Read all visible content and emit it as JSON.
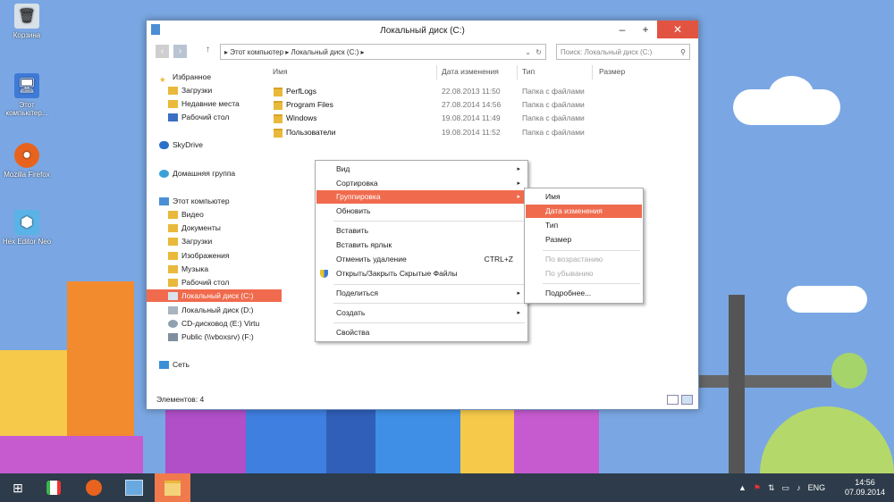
{
  "desktop": {
    "icons": [
      {
        "label": "Корзина",
        "icon": "recycle-bin-icon"
      },
      {
        "label": "Этот компьютер...",
        "icon": "computer-icon"
      },
      {
        "label": "Mozilla Firefox",
        "icon": "firefox-icon"
      },
      {
        "label": "Hex Editor Neo",
        "icon": "hex-editor-icon"
      }
    ]
  },
  "window": {
    "title": "Локальный диск (C:)",
    "address": "▸  Этот компьютер  ▸  Локальный диск (C:)  ▸",
    "search_placeholder": "Поиск: Локальный диск (C:)",
    "nav": {
      "favorites": "Избранное",
      "downloads": "Загрузки",
      "recent": "Недавние места",
      "desktop": "Рабочий стол",
      "skydrive": "SkyDrive",
      "homegroup": "Домашняя группа",
      "this_pc": "Этот компьютер",
      "video": "Видео",
      "documents": "Документы",
      "downloads2": "Загрузки",
      "images": "Изображения",
      "music": "Музыка",
      "desktop2": "Рабочий стол",
      "local_c": "Локальный диск (C:)",
      "local_d": "Локальный диск (D:)",
      "cd": "CD-дисковод (E:) Virtu",
      "public": "Public (\\\\vboxsrv) (F:)",
      "network": "Сеть"
    },
    "columns": {
      "name": "Имя",
      "date": "Дата изменения",
      "type": "Тип",
      "size": "Размер"
    },
    "files": [
      {
        "name": "PerfLogs",
        "date": "22.08.2013 11:50",
        "type": "Папка с файлами"
      },
      {
        "name": "Program Files",
        "date": "27.08.2014 14:56",
        "type": "Папка с файлами"
      },
      {
        "name": "Windows",
        "date": "19.08.2014 11:49",
        "type": "Папка с файлами"
      },
      {
        "name": "Пользователи",
        "date": "19.08.2014 11:52",
        "type": "Папка с файлами"
      }
    ],
    "status": "Элементов: 4"
  },
  "context_menu": {
    "view": "Вид",
    "sort": "Сортировка",
    "group": "Группировка",
    "refresh": "Обновить",
    "paste": "Вставить",
    "paste_shortcut": "Вставить ярлык",
    "undo_delete": "Отменить удаление",
    "undo_shortcut": "CTRL+Z",
    "toggle_hidden": "Открыть/Закрыть Скрытые Файлы",
    "share": "Поделиться",
    "create": "Создать",
    "properties": "Свойства"
  },
  "submenu": {
    "name": "Имя",
    "date": "Дата изменения",
    "type": "Тип",
    "size": "Размер",
    "asc": "По возрастанию",
    "desc": "По убыванию",
    "more": "Подробнее..."
  },
  "taskbar": {
    "lang": "ENG",
    "time": "14:56",
    "date": "07.09.2014"
  }
}
